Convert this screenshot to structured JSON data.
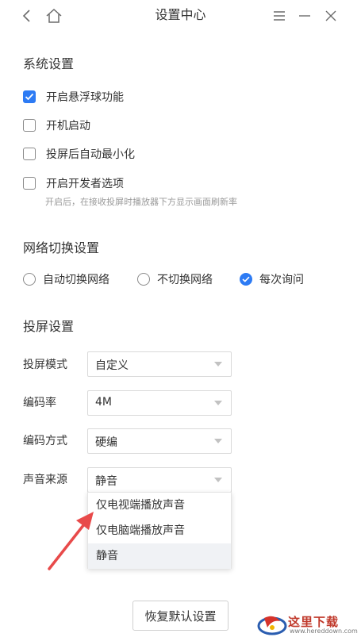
{
  "window": {
    "title": "设置中心",
    "icons": [
      "back-icon",
      "home-icon",
      "menu-icon",
      "minimize-icon",
      "close-icon"
    ]
  },
  "system_settings": {
    "title": "系统设置",
    "options": [
      {
        "label": "开启悬浮球功能",
        "checked": true
      },
      {
        "label": "开机启动",
        "checked": false
      },
      {
        "label": "投屏后自动最小化",
        "checked": false
      },
      {
        "label": "开启开发者选项",
        "checked": false
      }
    ],
    "developer_hint": "开启后，在接收投屏时播放器下方显示画面刷新率"
  },
  "network_settings": {
    "title": "网络切换设置",
    "options": [
      {
        "label": "自动切换网络",
        "checked": false
      },
      {
        "label": "不切换网络",
        "checked": false
      },
      {
        "label": "每次询问",
        "checked": true
      }
    ]
  },
  "screen_settings": {
    "title": "投屏设置",
    "fields": [
      {
        "label": "投屏模式",
        "value": "自定义"
      },
      {
        "label": "编码率",
        "value": "4M"
      },
      {
        "label": "编码方式",
        "value": "硬编"
      },
      {
        "label": "声音来源",
        "value": "静音"
      }
    ],
    "audio_dropdown": {
      "options": [
        "仅电视端播放声音",
        "仅电脑端播放声音",
        "静音"
      ],
      "selected": "静音"
    }
  },
  "reset_button": "恢复默认设置",
  "watermark": {
    "text": "这里下载",
    "url": "www.hereddown.com"
  },
  "colors": {
    "accent": "#2d7bf4",
    "annotation_arrow": "#e84a4a"
  }
}
